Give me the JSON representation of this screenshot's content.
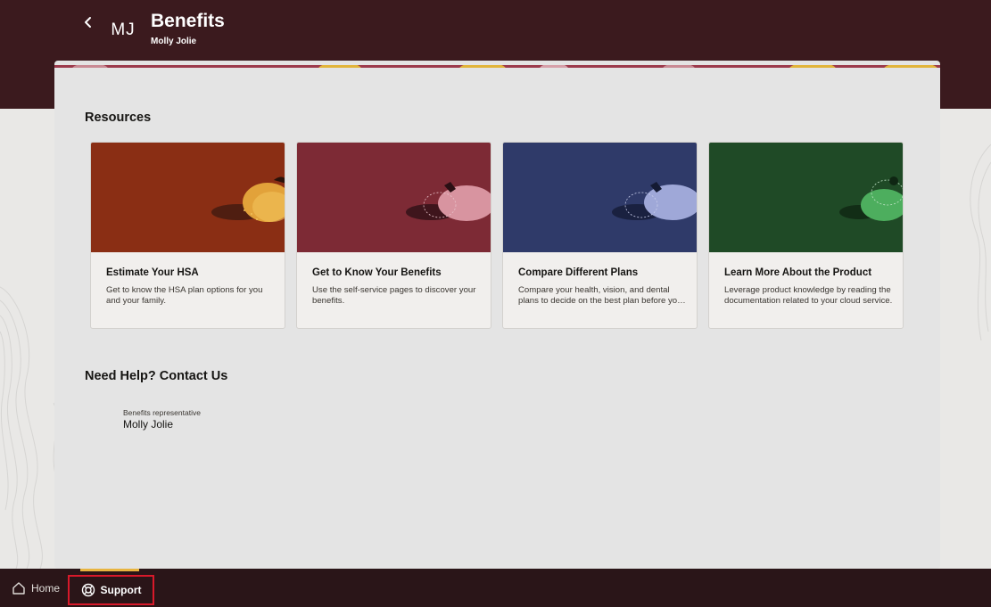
{
  "header": {
    "title": "Benefits",
    "subtitle": "Molly Jolie",
    "avatar_initials": "MJ",
    "back_icon": "chevron-left-icon"
  },
  "resources": {
    "heading": "Resources",
    "cards": [
      {
        "title": "Estimate Your HSA",
        "description": "Get to know the HSA plan options for you and your family.",
        "color": "#8a2e14"
      },
      {
        "title": "Get to Know Your Benefits",
        "description": "Use the self-service pages to discover your benefits.",
        "color": "#7d2a35"
      },
      {
        "title": "Compare Different Plans",
        "description": "Compare your health, vision, and dental plans to decide on the best plan before you enroll.",
        "color": "#2f3a69"
      },
      {
        "title": "Learn More About the Product",
        "description": "Leverage product knowledge by reading the documentation related to your cloud service.",
        "color": "#1f4a26"
      }
    ]
  },
  "help": {
    "heading": "Need Help? Contact Us",
    "contact_role": "Benefits representative",
    "contact_name": "Molly Jolie"
  },
  "footer": {
    "home_label": "Home",
    "home_icon": "home-icon",
    "support_label": "Support",
    "support_icon": "lifebuoy-icon",
    "active_color": "#e8b43f",
    "highlight_color": "#d8192a"
  }
}
